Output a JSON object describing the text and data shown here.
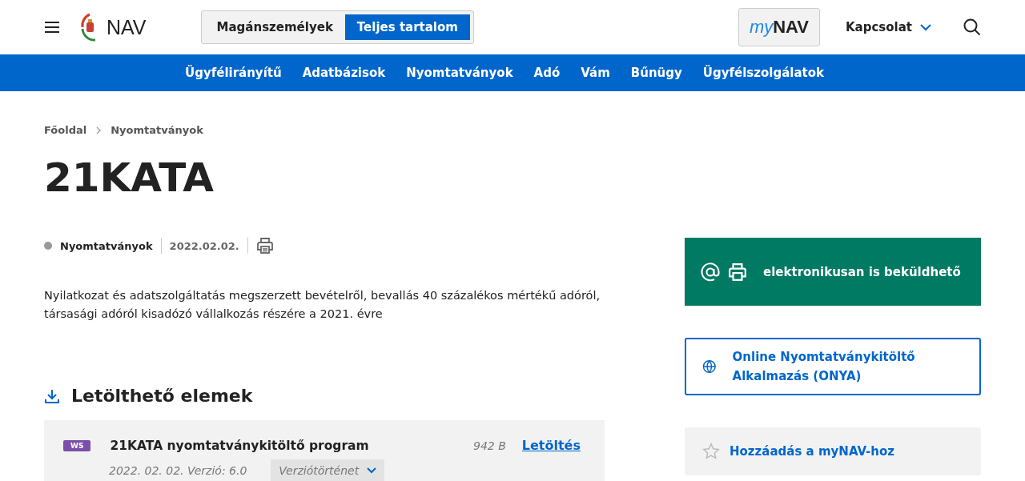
{
  "header": {
    "logo_text": "NAV",
    "audience_tabs": [
      {
        "label": "Magánszemélyek",
        "selected": false
      },
      {
        "label": "Teljes tartalom",
        "selected": true
      }
    ],
    "mynav": {
      "prefix": "my",
      "main": "NAV"
    },
    "contact": "Kapcsolat"
  },
  "nav": [
    "Ügyfélirányítű",
    "Adatbázisok",
    "Nyomtatványok",
    "Adó",
    "Vám",
    "Bűnügy",
    "Ügyfélszolgálatok"
  ],
  "breadcrumb": [
    "Főoldal",
    "Nyomtatványok"
  ],
  "title": "21KATA",
  "meta": {
    "category": "Nyomtatványok",
    "date": "2022.02.02."
  },
  "description": "Nyilatkozat és adatszolgáltatás megszerzett bevételről, bevallás 40 százalékos mértékű adóról, társasági adóról kisadózó vállalkozás részére a 2021. évre",
  "downloads": {
    "heading": "Letölthető elemek",
    "items": [
      {
        "badge": "WS",
        "name": "21KATA nyomtatványkitöltő program",
        "size": "942 B",
        "link": "Letöltés",
        "date_version": "2022. 02. 02. Verzió: 6.0",
        "history": "Verziótörténet"
      }
    ]
  },
  "sidebar": {
    "submit": "elektronikusan is beküldhető",
    "onya": "Online Nyomtatványkitöltő Alkalmazás (ONYA)",
    "add": "Hozzáadás a myNAV-hoz"
  }
}
